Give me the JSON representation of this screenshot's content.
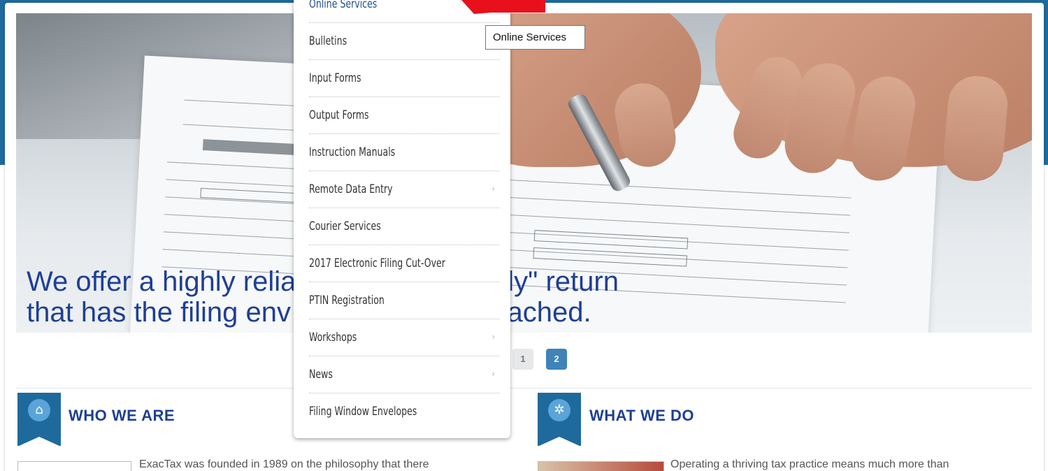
{
  "hero": {
    "caption_line1": "We offer a highly reliable \"print ready\" return",
    "caption_line2": "that has the filing envelope attached.",
    "caption_visible_left1": "We offer a highly relia",
    "caption_visible_right1": "eady\" return",
    "caption_visible_left2": "that has the filing env",
    "caption_visible_right2": "attached."
  },
  "pagination": {
    "pages": [
      "1",
      "2"
    ],
    "active": "2"
  },
  "sections": {
    "who": {
      "title": "WHO WE ARE",
      "icon": "home-icon",
      "text": "ExacTax was founded in 1989 on the philosophy that there"
    },
    "what": {
      "title": "WHAT WE DO",
      "icon": "gear-icon",
      "text": "Operating a thriving tax practice means much more than"
    }
  },
  "menu": {
    "items": [
      {
        "label": "Online Services",
        "submenu": false
      },
      {
        "label": "Bulletins",
        "submenu": false
      },
      {
        "label": "Input Forms",
        "submenu": false
      },
      {
        "label": "Output Forms",
        "submenu": false
      },
      {
        "label": "Instruction Manuals",
        "submenu": false
      },
      {
        "label": "Remote Data Entry",
        "submenu": true
      },
      {
        "label": "Courier Services",
        "submenu": false
      },
      {
        "label": "2017 Electronic Filing Cut-Over",
        "submenu": false
      },
      {
        "label": "PTIN Registration",
        "submenu": false
      },
      {
        "label": "Workshops",
        "submenu": true
      },
      {
        "label": "News",
        "submenu": true
      },
      {
        "label": "Filing Window Envelopes",
        "submenu": false
      }
    ],
    "caret_glyph": "›"
  },
  "tooltip": {
    "text": "Online Services"
  },
  "colors": {
    "brand": "#1f6a9d",
    "caption": "#1f3f95",
    "active_page": "#3f83b8",
    "annotation_arrow": "#e8101a"
  }
}
